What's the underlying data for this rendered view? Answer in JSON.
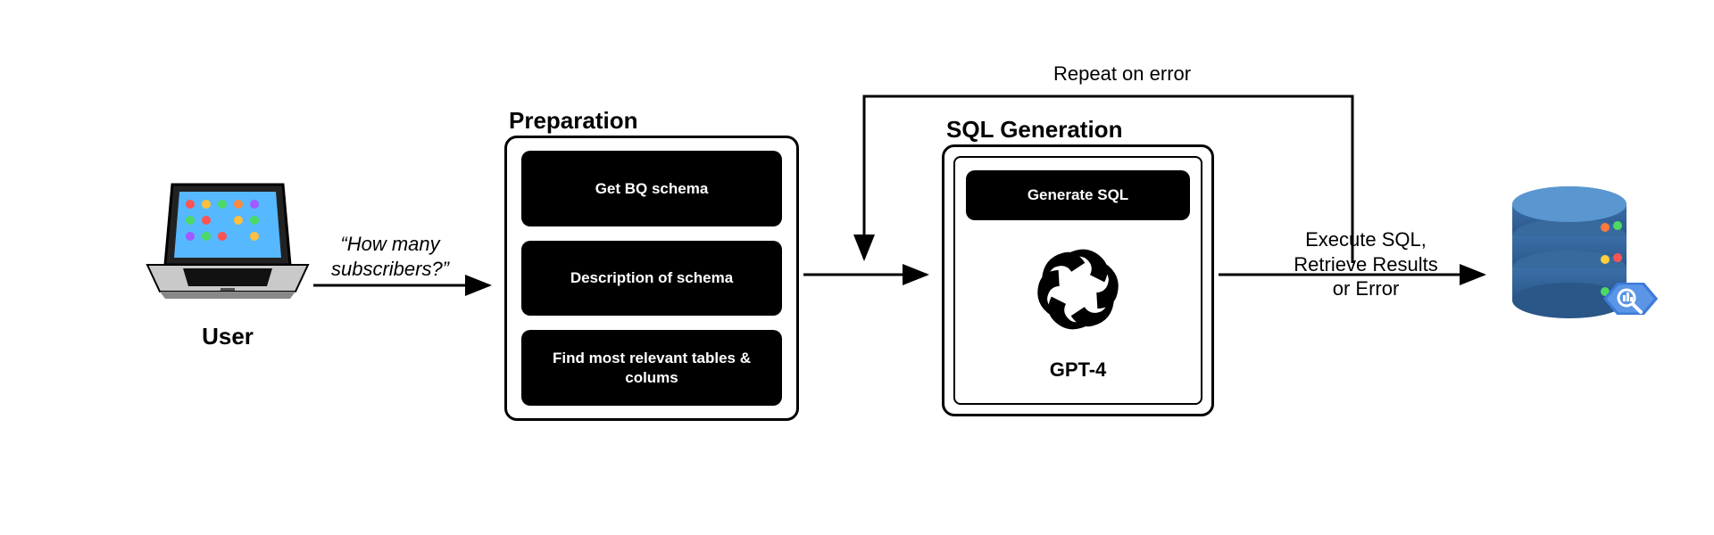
{
  "user": {
    "label": "User",
    "query": "“How many subscribers?”"
  },
  "preparation": {
    "title": "Preparation",
    "steps": [
      "Get BQ schema",
      "Description of schema",
      "Find most relevant tables & colums"
    ]
  },
  "sql_generation": {
    "title": "SQL Generation",
    "step": "Generate SQL",
    "model": "GPT-4"
  },
  "repeat_label": "Repeat on error",
  "execute_label": "Execute SQL,\nRetrieve Results\nor Error"
}
